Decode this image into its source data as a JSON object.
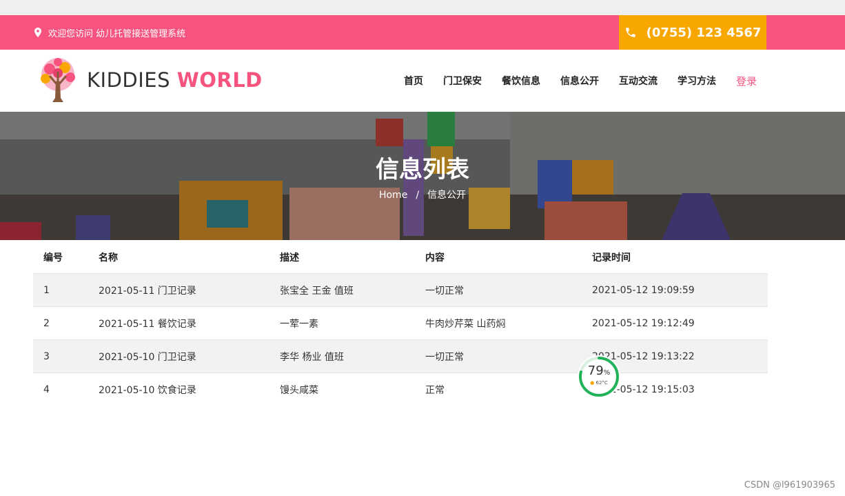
{
  "topbar": {
    "welcome_text": "欢迎您访问 幼儿托管接送管理系统",
    "phone": "(0755) 123 4567"
  },
  "logo": {
    "word1": "KIDDIES ",
    "word2": "WORLD"
  },
  "nav": {
    "items": [
      "首页",
      "门卫保安",
      "餐饮信息",
      "信息公开",
      "互动交流",
      "学习方法"
    ],
    "login": "登录"
  },
  "hero": {
    "title": "信息列表",
    "breadcrumb_home": "Home",
    "breadcrumb_sep": "/",
    "breadcrumb_current": "信息公开"
  },
  "table": {
    "headers": [
      "编号",
      "名称",
      "描述",
      "内容",
      "记录时间"
    ],
    "rows": [
      [
        "1",
        "2021-05-11 门卫记录",
        "张宝全 王金 值班",
        "一切正常",
        "2021-05-12 19:09:59"
      ],
      [
        "2",
        "2021-05-11 餐饮记录",
        "一荤一素",
        "牛肉炒芹菜 山药焖",
        "2021-05-12 19:12:49"
      ],
      [
        "3",
        "2021-05-10 门卫记录",
        "李华 杨业 值班",
        "一切正常",
        "2021-05-12 19:13:22"
      ],
      [
        "4",
        "2021-05-10 饮食记录",
        "馒头咸菜",
        "正常",
        "2021-05-12 19:15:03"
      ]
    ]
  },
  "widget": {
    "percent": "79",
    "percent_unit": "%",
    "temperature": "62°C",
    "level": 0.79
  },
  "watermark": "CSDN @l961903965",
  "colors": {
    "brand_pink": "#f6537f",
    "phone_orange": "#f7a700",
    "widget_green": "#22b35a"
  }
}
